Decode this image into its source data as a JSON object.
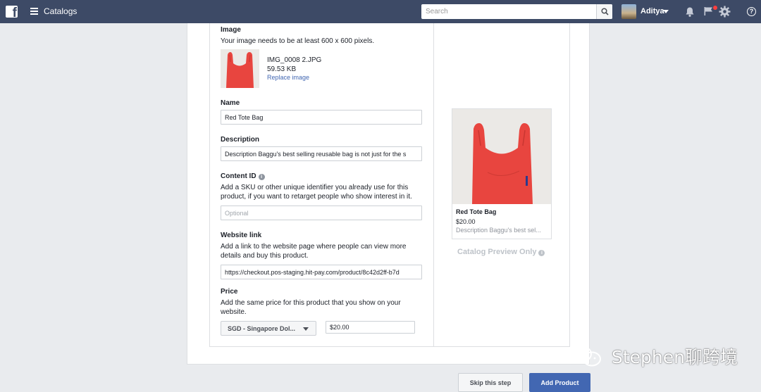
{
  "header": {
    "app_title": "Catalogs",
    "search_placeholder": "Search",
    "user_name": "Aditya"
  },
  "form": {
    "image": {
      "label": "Image",
      "help": "Your image needs to be at least 600 x 600 pixels.",
      "file_name": "IMG_0008 2.JPG",
      "file_size": "59.53 KB",
      "replace_link": "Replace image"
    },
    "name": {
      "label": "Name",
      "value": "Red Tote Bag"
    },
    "description": {
      "label": "Description",
      "value": "Description Baggu's best selling reusable bag is not just for the s"
    },
    "content_id": {
      "label": "Content ID",
      "help": "Add a SKU or other unique identifier you already use for this product, if you want to retarget people who show interest in it.",
      "placeholder": "Optional"
    },
    "website_link": {
      "label": "Website link",
      "help": "Add a link to the website page where people can view more details and buy this product.",
      "value": "https://checkout.pos-staging.hit-pay.com/product/8c42d2ff-b7d"
    },
    "price": {
      "label": "Price",
      "help": "Add the same price for this product that you show on your website.",
      "currency": "SGD - Singapore Dol...",
      "value": "$20.00"
    }
  },
  "preview": {
    "title": "Red Tote Bag",
    "price": "$20.00",
    "description": "Description Baggu's best sel...",
    "note": "Catalog Preview Only"
  },
  "footer": {
    "skip_label": "Skip this step",
    "add_label": "Add Product"
  },
  "watermark": {
    "text": "Stephen聊跨境"
  },
  "colors": {
    "topbar": "#3d4a66",
    "primary": "#4267b2",
    "bag_red": "#e8453f"
  }
}
